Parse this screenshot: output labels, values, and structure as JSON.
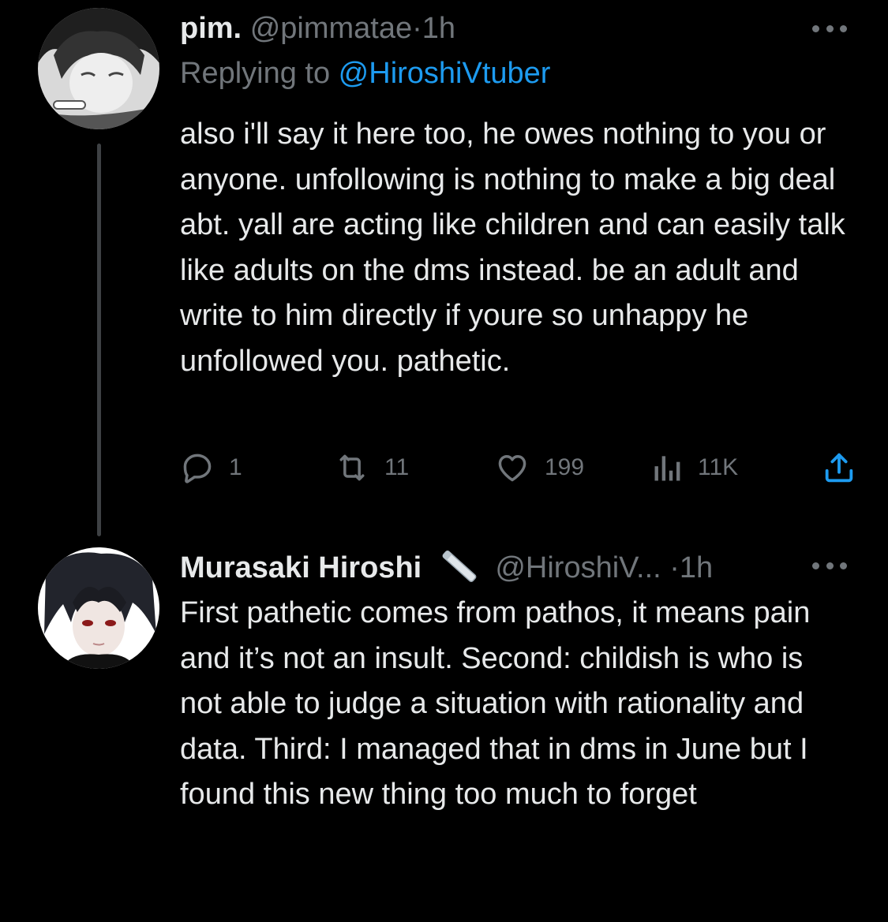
{
  "tweets": [
    {
      "name": "pim.",
      "handle": "@pimmatae",
      "dot": "·",
      "time": "1h",
      "replying_prefix": "Replying to ",
      "replying_handle": "@HiroshiVtuber",
      "text": "also i'll say it here too, he owes nothing to you or anyone. unfollowing is nothing to make a big deal abt. yall are acting like children and can easily talk like adults on the dms instead. be an adult and write to him directly if youre so unhappy he unfollowed you. pathetic.",
      "actions": {
        "replies": "1",
        "retweets": "11",
        "likes": "199",
        "views": "11K"
      }
    },
    {
      "name": "Murasaki Hiroshi",
      "handle": "@HiroshiV...",
      "dot": "·",
      "time": "1h",
      "text": "First pathetic comes from pathos, it means pain and it’s not an insult. Second: childish is who is not able to judge a situation with rationality and data. Third: I managed that in dms in June but I found this new thing too much to forget"
    }
  ],
  "icons": [
    "more-icon",
    "reply-icon",
    "retweet-icon",
    "like-icon",
    "views-icon",
    "share-icon",
    "emoji-icon"
  ],
  "colors": {
    "background": "#000000",
    "text": "#e7e9ea",
    "muted": "#71767b",
    "link": "#1d9bf0"
  }
}
